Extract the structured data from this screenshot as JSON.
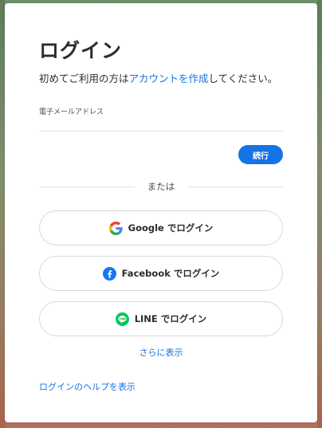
{
  "page": {
    "title": "ログイン",
    "subtitle_prefix": "初めてご利用の方は",
    "subtitle_link": "アカウントを作成",
    "subtitle_suffix": "してください。"
  },
  "email": {
    "label": "電子メールアドレス",
    "value": "",
    "placeholder": ""
  },
  "actions": {
    "continue_label": "続行"
  },
  "divider": {
    "text": "または"
  },
  "social": {
    "google_label": "Google でログイン",
    "facebook_label": "Facebook でログイン",
    "line_label": "LINE でログイン"
  },
  "links": {
    "more": "さらに表示",
    "help": "ログインのヘルプを表示"
  },
  "icons": {
    "google": "google-logo",
    "facebook": "facebook-logo",
    "line": "line-logo"
  },
  "colors": {
    "accent": "#1473e6",
    "facebook": "#1877f2",
    "line": "#06c755"
  }
}
